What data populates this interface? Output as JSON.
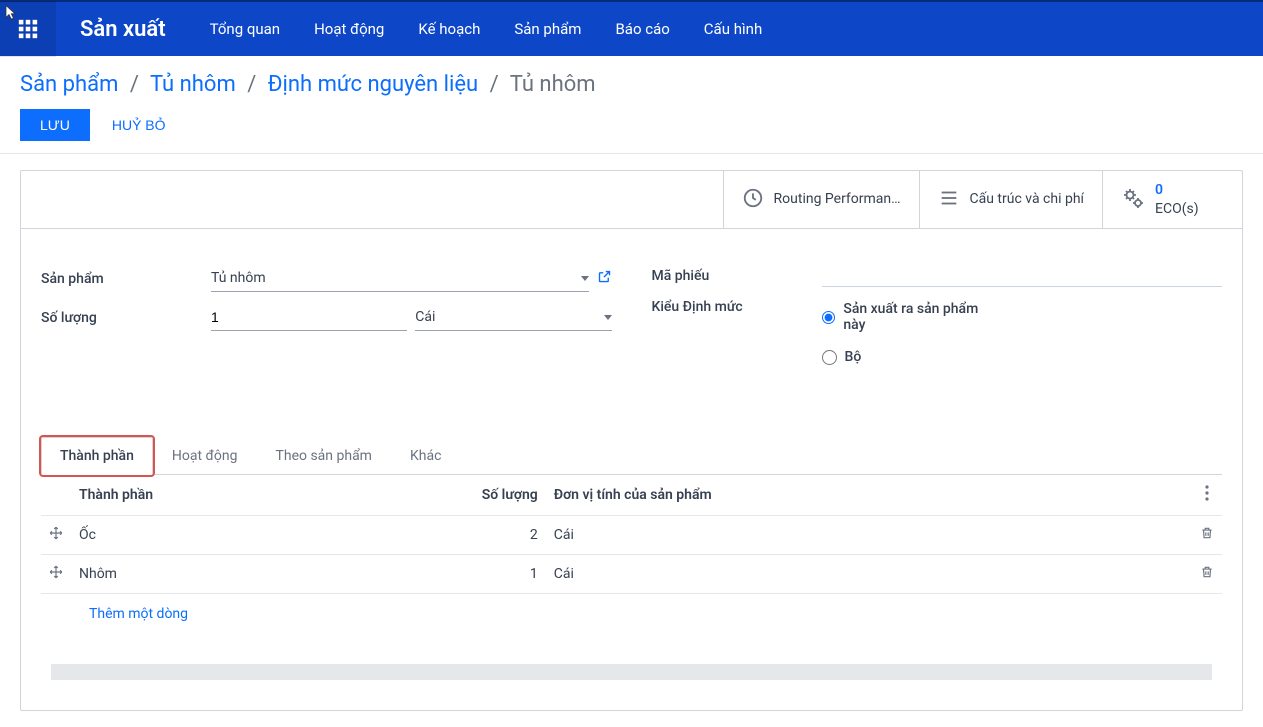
{
  "app_title": "Sản xuất",
  "nav": [
    "Tổng quan",
    "Hoạt động",
    "Kế hoạch",
    "Sản phẩm",
    "Báo cáo",
    "Cấu hình"
  ],
  "breadcrumb": {
    "parts": [
      "Sản phẩm",
      "Tủ nhôm",
      "Định mức nguyên liệu"
    ],
    "current": "Tủ nhôm"
  },
  "actions": {
    "save": "LƯU",
    "discard": "HUỶ BỎ"
  },
  "status_buttons": {
    "routing": "Routing Performan…",
    "structure": "Cấu trúc và chi phí",
    "eco_count": "0",
    "eco_label": "ECO(s)"
  },
  "form": {
    "product_label": "Sản phẩm",
    "product_value": "Tủ nhôm",
    "qty_label": "Số lượng",
    "qty_value": "1",
    "qty_unit": "Cái",
    "reference_label": "Mã phiếu",
    "reference_value": "",
    "bomtype_label": "Kiểu Định mức",
    "bomtype_options": [
      "Sản xuất ra sản phẩm này",
      "Bộ"
    ],
    "bomtype_selected": 0
  },
  "tabs": [
    "Thành phần",
    "Hoạt động",
    "Theo sản phẩm",
    "Khác"
  ],
  "active_tab": 0,
  "table": {
    "headers": {
      "component": "Thành phần",
      "qty": "Số lượng",
      "uom": "Đơn vị tính của sản phẩm"
    },
    "rows": [
      {
        "component": "Ốc",
        "qty": "2",
        "uom": "Cái"
      },
      {
        "component": "Nhôm",
        "qty": "1",
        "uom": "Cái"
      }
    ],
    "add_line": "Thêm một dòng"
  }
}
